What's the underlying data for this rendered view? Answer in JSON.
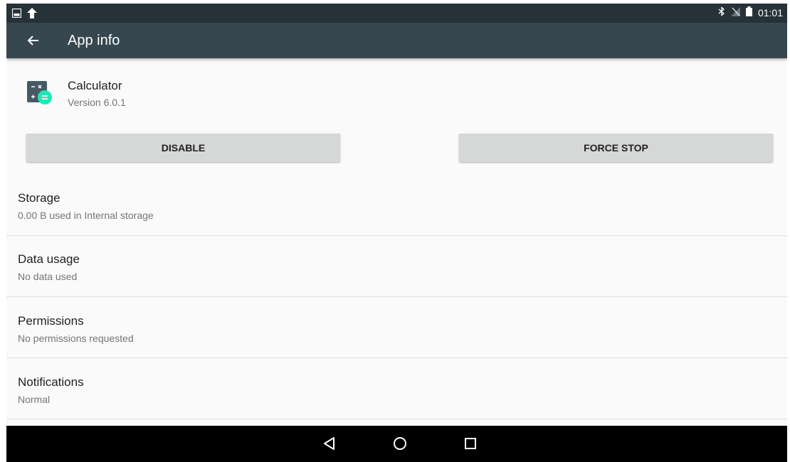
{
  "status_bar": {
    "time": "01:01",
    "left_icons": [
      "gallery-icon",
      "upload-icon"
    ],
    "right_icons": [
      "bluetooth-icon",
      "no-sim-icon",
      "battery-icon"
    ]
  },
  "app_bar": {
    "title": "App info",
    "back_icon": "arrow-back-icon"
  },
  "app": {
    "name": "Calculator",
    "version": "Version 6.0.1",
    "icon": "calculator-icon"
  },
  "buttons": {
    "disable": "DISABLE",
    "force_stop": "FORCE STOP"
  },
  "items": [
    {
      "title": "Storage",
      "subtitle": "0.00 B used in Internal storage"
    },
    {
      "title": "Data usage",
      "subtitle": "No data used"
    },
    {
      "title": "Permissions",
      "subtitle": "No permissions requested"
    },
    {
      "title": "Notifications",
      "subtitle": "Normal"
    }
  ],
  "nav_bar": {
    "buttons": [
      "back-icon",
      "home-icon",
      "recents-icon"
    ]
  },
  "colors": {
    "status_bar": "#263238",
    "app_bar": "#37474f",
    "background": "#fafafa",
    "button": "#d6d7d7",
    "accent": "#1de9b6"
  }
}
